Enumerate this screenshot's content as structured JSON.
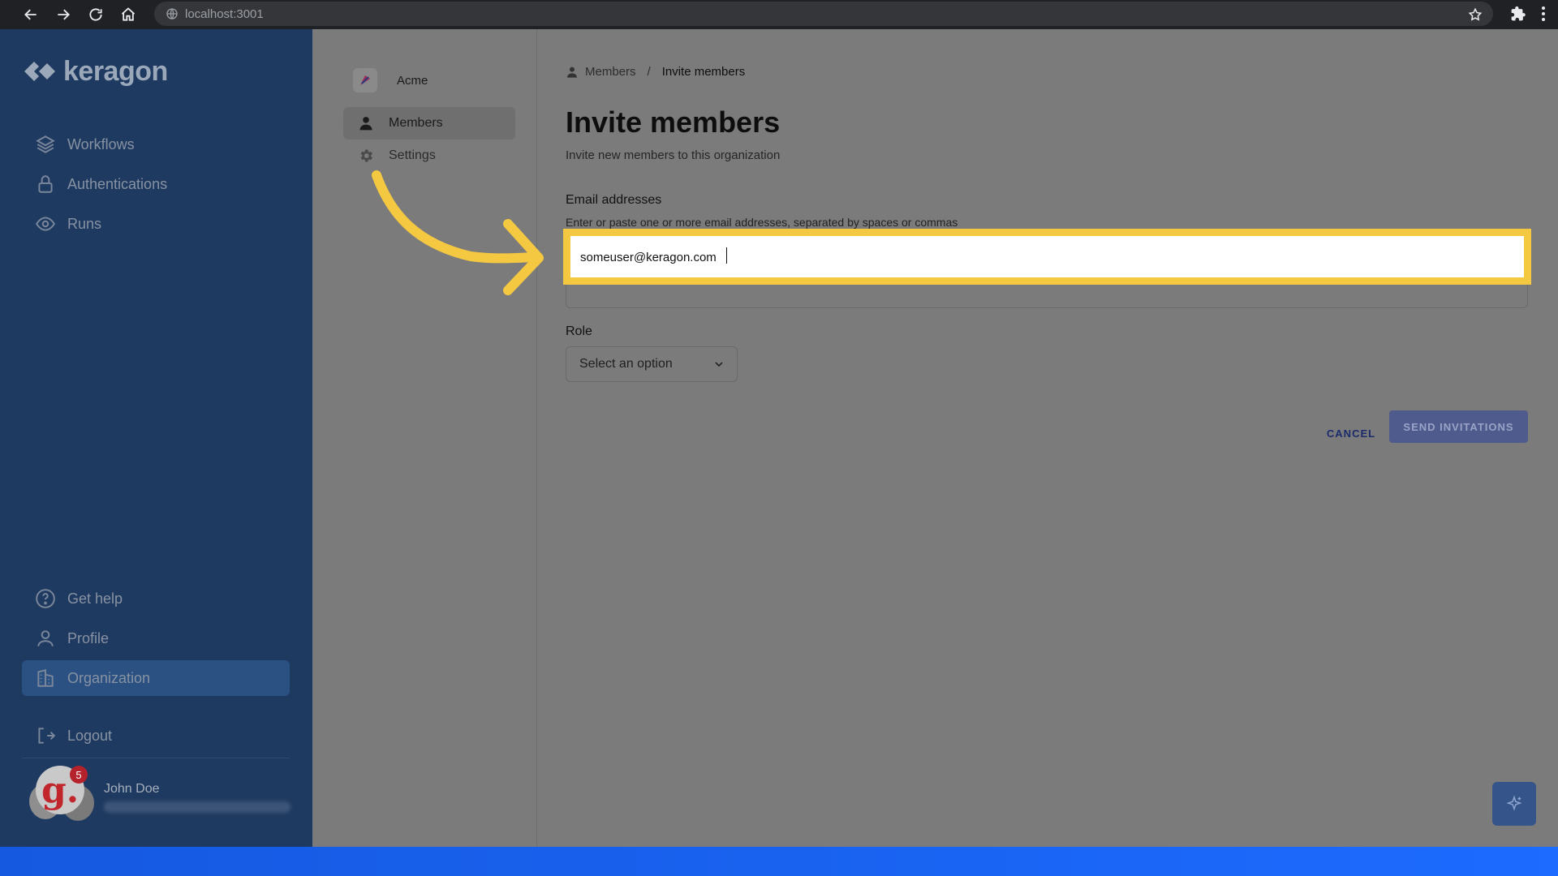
{
  "browser": {
    "url": "localhost:3001"
  },
  "sidebar": {
    "logo_text": "keragon",
    "items": [
      {
        "label": "Workflows",
        "icon": "layers-icon"
      },
      {
        "label": "Authentications",
        "icon": "lock-icon"
      },
      {
        "label": "Runs",
        "icon": "eye-icon"
      }
    ],
    "bottom_items": [
      {
        "label": "Get help",
        "icon": "question-circle-icon"
      },
      {
        "label": "Profile",
        "icon": "person-icon"
      },
      {
        "label": "Organization",
        "icon": "building-icon",
        "active": true
      },
      {
        "label": "Logout",
        "icon": "logout-icon"
      }
    ],
    "user": {
      "name": "John Doe",
      "avatar_letter": "g.",
      "notification_count": "5"
    }
  },
  "subnav": {
    "org_name": "Acme",
    "items": [
      {
        "label": "Members",
        "icon": "person-icon",
        "active": true
      },
      {
        "label": "Settings",
        "icon": "gear-icon",
        "active": false
      }
    ]
  },
  "main": {
    "breadcrumb": {
      "parent": "Members",
      "separator": "/",
      "current": "Invite members"
    },
    "title": "Invite members",
    "subtitle": "Invite new members to this organization",
    "email_field": {
      "label": "Email addresses",
      "help": "Enter or paste one or more email addresses, separated by spaces or commas",
      "value": "someuser@keragon.com"
    },
    "role_field": {
      "label": "Role",
      "placeholder": "Select an option"
    },
    "cancel_label": "CANCEL",
    "send_label": "SEND INVITATIONS"
  },
  "colors": {
    "sidebar_bg": "#1f3a60",
    "highlight": "#f5c842",
    "primary_button": "#4f5b8c",
    "bottom_band": "#1d6bff"
  }
}
